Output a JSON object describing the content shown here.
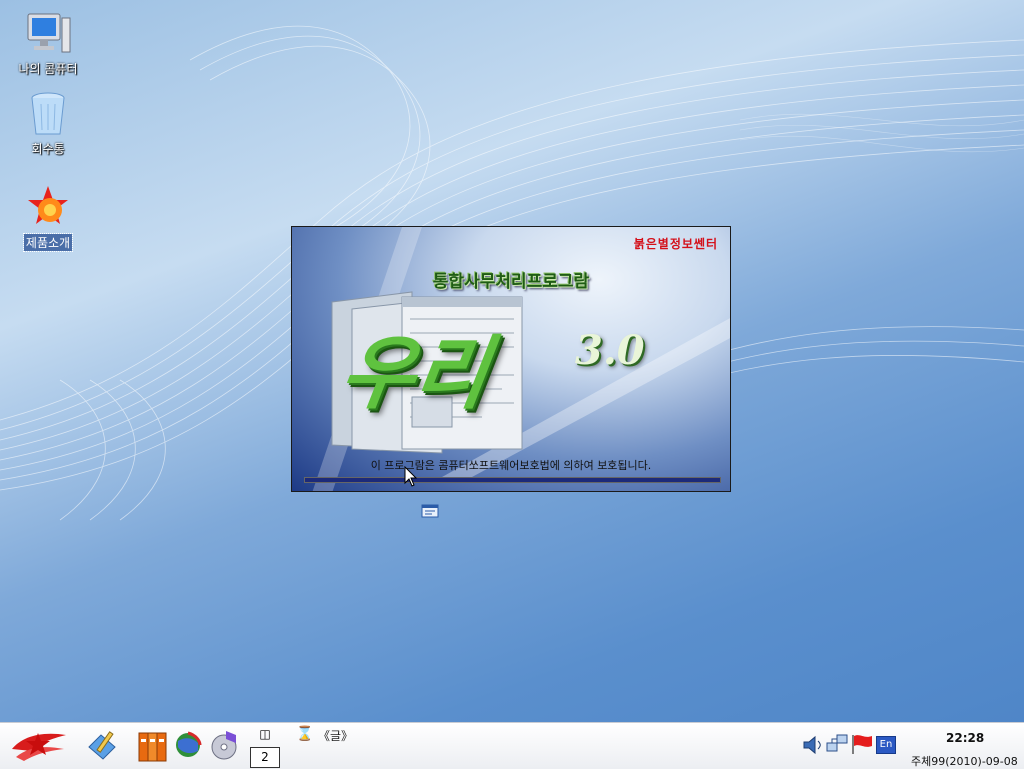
{
  "desktop": {
    "icons": [
      {
        "label": "나의 콤퓨터",
        "icon": "computer-icon"
      },
      {
        "label": "회수통",
        "icon": "recycle-bin-icon"
      },
      {
        "label": "제품소개",
        "icon": "product-intro-icon",
        "selected": true
      }
    ]
  },
  "splash": {
    "publisher": "붉은별정보쎈터",
    "subtitle": "통합사무처리프로그람",
    "logo": "우리",
    "version": "3.0",
    "notice": "이 프로그람은 콤퓨터쏘프트웨어보호법에 의하여 보호됩니다.",
    "progress_fraction": 1.0
  },
  "taskbar": {
    "launchers": [
      {
        "icon": "red-star-menu-icon"
      },
      {
        "icon": "editor-icon"
      },
      {
        "icon": "office-suite-icon"
      },
      {
        "icon": "browser-globe-icon"
      },
      {
        "icon": "media-icon"
      }
    ],
    "pager_top": "◫",
    "workspace": "2",
    "task_hourglass": "⌛",
    "task_label": "《글》",
    "tray": [
      {
        "icon": "volume-icon"
      },
      {
        "icon": "network-icon"
      },
      {
        "icon": "flag-icon"
      },
      {
        "icon": "input-method-icon",
        "label": "En"
      }
    ],
    "time": "22:28",
    "date": "주체99(2010)-09-08"
  },
  "colors": {
    "publisher_red": "#d4101a",
    "logo_green": "#5fc23f",
    "progress_navy": "#1c2a7a"
  }
}
